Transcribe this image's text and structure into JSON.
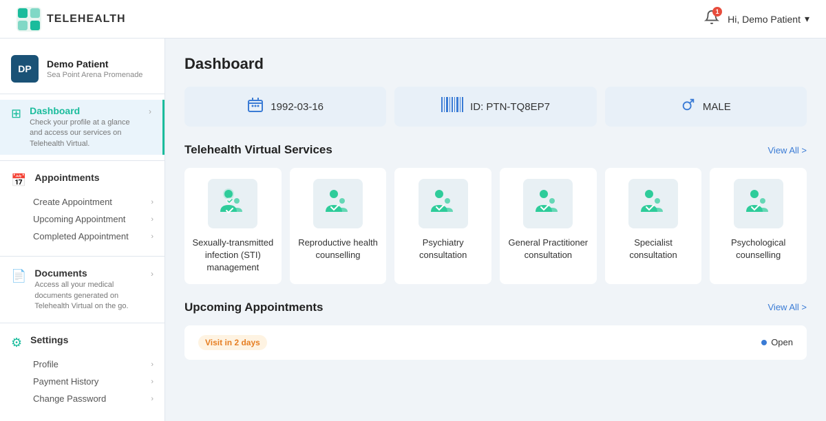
{
  "topnav": {
    "logo_text": "TELEHEALTH",
    "notification_count": "1",
    "user_greeting": "Hi, Demo Patient"
  },
  "sidebar": {
    "user": {
      "initials": "DP",
      "name": "Demo Patient",
      "address": "Sea Point Arena Promenade"
    },
    "nav_items": [
      {
        "id": "dashboard",
        "title": "Dashboard",
        "desc": "Check your profile at a glance and access our services on Telehealth Virtual.",
        "active": true,
        "has_arrow": true,
        "sub_items": []
      },
      {
        "id": "appointments",
        "title": "Appointments",
        "desc": "",
        "active": false,
        "has_arrow": false,
        "sub_items": [
          {
            "label": "Create Appointment"
          },
          {
            "label": "Upcoming Appointment"
          },
          {
            "label": "Completed Appointment"
          }
        ]
      },
      {
        "id": "documents",
        "title": "Documents",
        "desc": "Access all your medical documents generated on Telehealth Virtual on the go.",
        "active": false,
        "has_arrow": true,
        "sub_items": []
      },
      {
        "id": "settings",
        "title": "Settings",
        "desc": "",
        "active": false,
        "has_arrow": false,
        "sub_items": [
          {
            "label": "Profile"
          },
          {
            "label": "Payment History"
          },
          {
            "label": "Change Password"
          }
        ]
      }
    ]
  },
  "content": {
    "page_title": "Dashboard",
    "info_cards": [
      {
        "icon": "🎂",
        "value": "1992-03-16"
      },
      {
        "icon": "▌▌▌▌▌",
        "value": "ID: PTN-TQ8EP7"
      },
      {
        "icon": "♂",
        "value": "MALE"
      }
    ],
    "services_section": {
      "title": "Telehealth Virtual Services",
      "view_all": "View All >",
      "items": [
        {
          "label": "Sexually-transmitted infection (STI) management"
        },
        {
          "label": "Reproductive health counselling"
        },
        {
          "label": "Psychiatry consultation"
        },
        {
          "label": "General Practitioner consultation"
        },
        {
          "label": "Specialist consultation"
        },
        {
          "label": "Psychological counselling"
        }
      ]
    },
    "appointments_section": {
      "title": "Upcoming Appointments",
      "view_all": "View All >",
      "items": [
        {
          "badge": "Visit in 2 days",
          "status": "Open"
        }
      ]
    }
  }
}
